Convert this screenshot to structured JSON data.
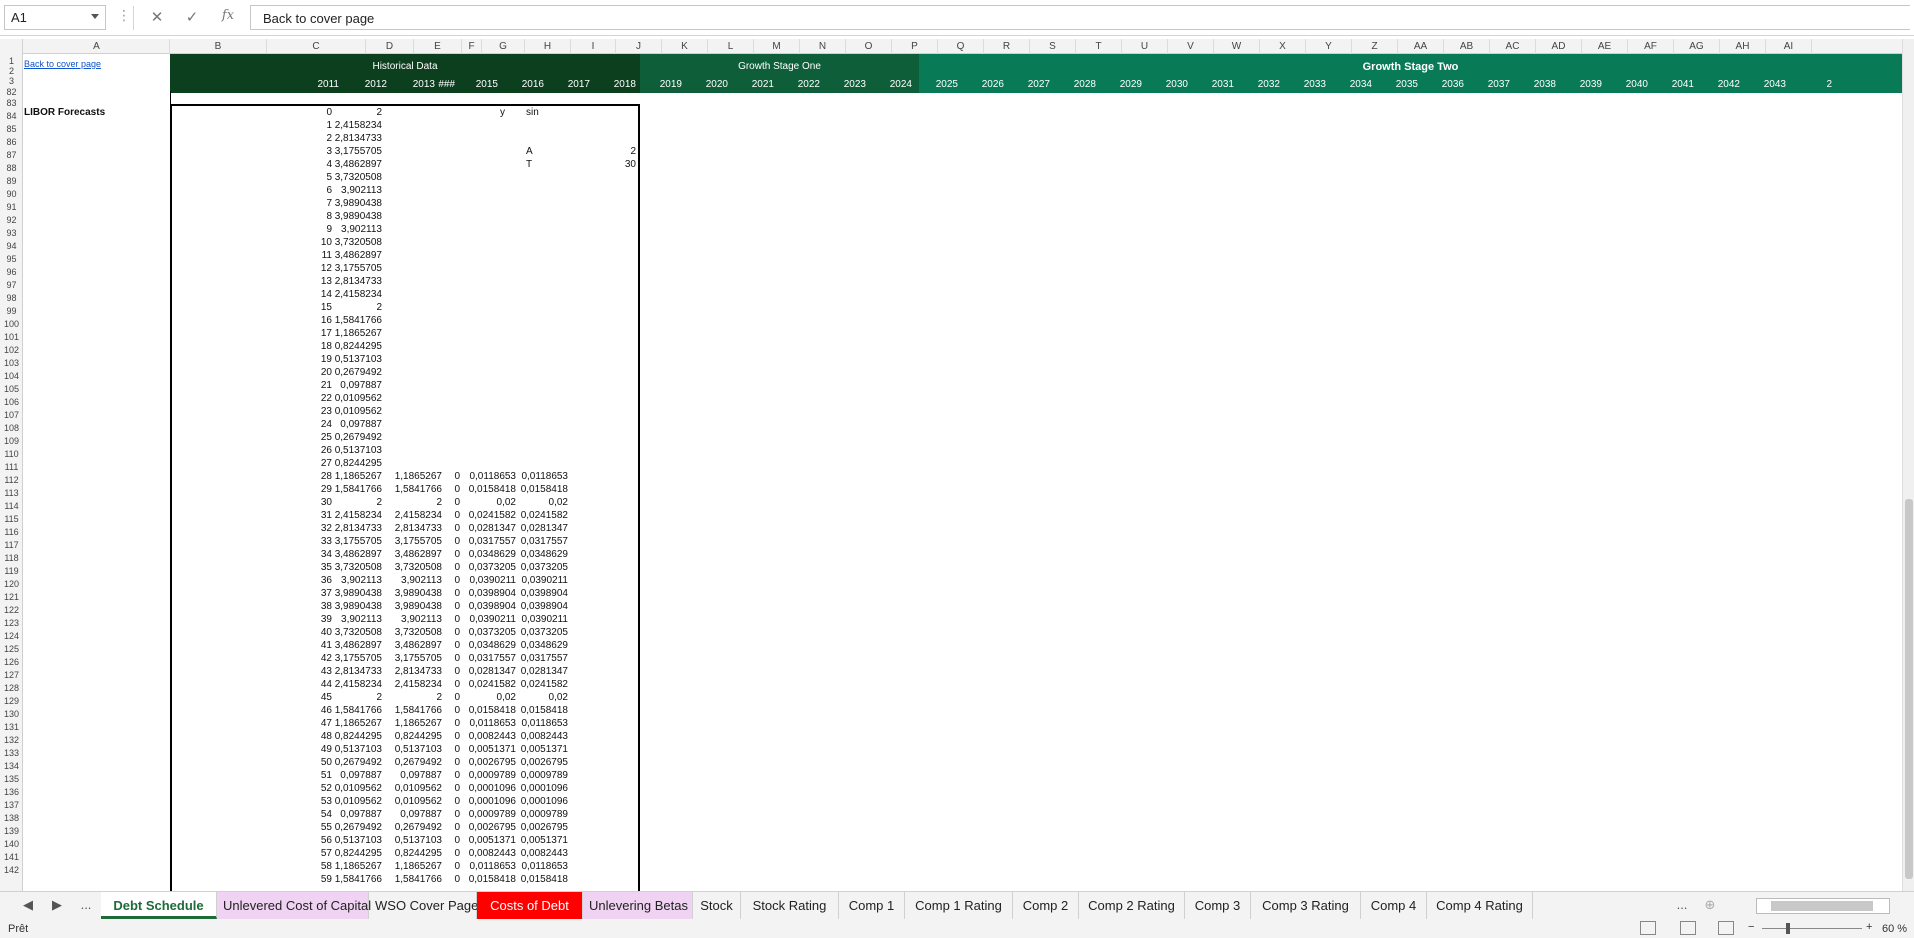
{
  "formula_bar": {
    "name_box": "A1",
    "formula": "Back to cover page",
    "fx": "fx",
    "cancel": "✕",
    "enter": "✓"
  },
  "columns": [
    "A",
    "B",
    "C",
    "D",
    "E",
    "F",
    "G",
    "H",
    "I",
    "J",
    "K",
    "L",
    "M",
    "N",
    "O",
    "P",
    "Q",
    "R",
    "S",
    "T",
    "U",
    "V",
    "W",
    "X",
    "Y",
    "Z",
    "AA",
    "AB",
    "AC",
    "AD",
    "AE",
    "AF",
    "AG",
    "AH",
    "AI"
  ],
  "rows": [
    "1",
    "2",
    "3",
    "82",
    "83",
    "84",
    "85",
    "86",
    "87",
    "88",
    "89",
    "90",
    "91",
    "92",
    "93",
    "94",
    "95",
    "96",
    "97",
    "98",
    "99",
    "100",
    "101",
    "102",
    "103",
    "104",
    "105",
    "106",
    "107",
    "108",
    "109",
    "110",
    "111",
    "112",
    "113",
    "114",
    "115",
    "116",
    "117",
    "118",
    "119",
    "120",
    "121",
    "122",
    "123",
    "124",
    "125",
    "126",
    "127",
    "128",
    "129",
    "130",
    "131",
    "132",
    "133",
    "134",
    "135",
    "136",
    "137",
    "138",
    "139",
    "140",
    "141",
    "142"
  ],
  "header": {
    "link": "Back to cover page",
    "historical": "Historical Data",
    "stage_one": "Growth Stage One",
    "stage_two": "Growth Stage Two",
    "years_hist": [
      "2011",
      "2012",
      "2013",
      "###",
      "2015",
      "2016"
    ],
    "years_one": [
      "2017",
      "2018",
      "2019",
      "2020",
      "2021",
      "2022"
    ],
    "years_two": [
      "2023",
      "2024",
      "2025",
      "2026",
      "2027",
      "2028",
      "2029",
      "2030",
      "2031",
      "2032",
      "2033",
      "2034",
      "2035",
      "2036",
      "2037",
      "2038",
      "2039",
      "2040",
      "2041",
      "2042",
      "2043",
      "2"
    ]
  },
  "section_title": "LIBOR Forecasts",
  "labels": {
    "y": "y",
    "sin": "sin",
    "A": "A",
    "A_val": "2",
    "T": "T",
    "T_val": "30"
  },
  "table": [
    [
      "0",
      "2",
      "",
      "",
      "",
      ""
    ],
    [
      "1",
      "2,4158234",
      "",
      "",
      "",
      ""
    ],
    [
      "2",
      "2,8134733",
      "",
      "",
      "",
      ""
    ],
    [
      "3",
      "3,1755705",
      "",
      "",
      "",
      ""
    ],
    [
      "4",
      "3,4862897",
      "",
      "",
      "",
      ""
    ],
    [
      "5",
      "3,7320508",
      "",
      "",
      "",
      ""
    ],
    [
      "6",
      "3,902113",
      "",
      "",
      "",
      ""
    ],
    [
      "7",
      "3,9890438",
      "",
      "",
      "",
      ""
    ],
    [
      "8",
      "3,9890438",
      "",
      "",
      "",
      ""
    ],
    [
      "9",
      "3,902113",
      "",
      "",
      "",
      ""
    ],
    [
      "10",
      "3,7320508",
      "",
      "",
      "",
      ""
    ],
    [
      "11",
      "3,4862897",
      "",
      "",
      "",
      ""
    ],
    [
      "12",
      "3,1755705",
      "",
      "",
      "",
      ""
    ],
    [
      "13",
      "2,8134733",
      "",
      "",
      "",
      ""
    ],
    [
      "14",
      "2,4158234",
      "",
      "",
      "",
      ""
    ],
    [
      "15",
      "2",
      "",
      "",
      "",
      ""
    ],
    [
      "16",
      "1,5841766",
      "",
      "",
      "",
      ""
    ],
    [
      "17",
      "1,1865267",
      "",
      "",
      "",
      ""
    ],
    [
      "18",
      "0,8244295",
      "",
      "",
      "",
      ""
    ],
    [
      "19",
      "0,5137103",
      "",
      "",
      "",
      ""
    ],
    [
      "20",
      "0,2679492",
      "",
      "",
      "",
      ""
    ],
    [
      "21",
      "0,097887",
      "",
      "",
      "",
      ""
    ],
    [
      "22",
      "0,0109562",
      "",
      "",
      "",
      ""
    ],
    [
      "23",
      "0,0109562",
      "",
      "",
      "",
      ""
    ],
    [
      "24",
      "0,097887",
      "",
      "",
      "",
      ""
    ],
    [
      "25",
      "0,2679492",
      "",
      "",
      "",
      ""
    ],
    [
      "26",
      "0,5137103",
      "",
      "",
      "",
      ""
    ],
    [
      "27",
      "0,8244295",
      "",
      "",
      "",
      ""
    ],
    [
      "28",
      "1,1865267",
      "1,1865267",
      "0",
      "0,0118653",
      "0,0118653"
    ],
    [
      "29",
      "1,5841766",
      "1,5841766",
      "0",
      "0,0158418",
      "0,0158418"
    ],
    [
      "30",
      "2",
      "2",
      "0",
      "0,02",
      "0,02"
    ],
    [
      "31",
      "2,4158234",
      "2,4158234",
      "0",
      "0,0241582",
      "0,0241582"
    ],
    [
      "32",
      "2,8134733",
      "2,8134733",
      "0",
      "0,0281347",
      "0,0281347"
    ],
    [
      "33",
      "3,1755705",
      "3,1755705",
      "0",
      "0,0317557",
      "0,0317557"
    ],
    [
      "34",
      "3,4862897",
      "3,4862897",
      "0",
      "0,0348629",
      "0,0348629"
    ],
    [
      "35",
      "3,7320508",
      "3,7320508",
      "0",
      "0,0373205",
      "0,0373205"
    ],
    [
      "36",
      "3,902113",
      "3,902113",
      "0",
      "0,0390211",
      "0,0390211"
    ],
    [
      "37",
      "3,9890438",
      "3,9890438",
      "0",
      "0,0398904",
      "0,0398904"
    ],
    [
      "38",
      "3,9890438",
      "3,9890438",
      "0",
      "0,0398904",
      "0,0398904"
    ],
    [
      "39",
      "3,902113",
      "3,902113",
      "0",
      "0,0390211",
      "0,0390211"
    ],
    [
      "40",
      "3,7320508",
      "3,7320508",
      "0",
      "0,0373205",
      "0,0373205"
    ],
    [
      "41",
      "3,4862897",
      "3,4862897",
      "0",
      "0,0348629",
      "0,0348629"
    ],
    [
      "42",
      "3,1755705",
      "3,1755705",
      "0",
      "0,0317557",
      "0,0317557"
    ],
    [
      "43",
      "2,8134733",
      "2,8134733",
      "0",
      "0,0281347",
      "0,0281347"
    ],
    [
      "44",
      "2,4158234",
      "2,4158234",
      "0",
      "0,0241582",
      "0,0241582"
    ],
    [
      "45",
      "2",
      "2",
      "0",
      "0,02",
      "0,02"
    ],
    [
      "46",
      "1,5841766",
      "1,5841766",
      "0",
      "0,0158418",
      "0,0158418"
    ],
    [
      "47",
      "1,1865267",
      "1,1865267",
      "0",
      "0,0118653",
      "0,0118653"
    ],
    [
      "48",
      "0,8244295",
      "0,8244295",
      "0",
      "0,0082443",
      "0,0082443"
    ],
    [
      "49",
      "0,5137103",
      "0,5137103",
      "0",
      "0,0051371",
      "0,0051371"
    ],
    [
      "50",
      "0,2679492",
      "0,2679492",
      "0",
      "0,0026795",
      "0,0026795"
    ],
    [
      "51",
      "0,097887",
      "0,097887",
      "0",
      "0,0009789",
      "0,0009789"
    ],
    [
      "52",
      "0,0109562",
      "0,0109562",
      "0",
      "0,0001096",
      "0,0001096"
    ],
    [
      "53",
      "0,0109562",
      "0,0109562",
      "0",
      "0,0001096",
      "0,0001096"
    ],
    [
      "54",
      "0,097887",
      "0,097887",
      "0",
      "0,0009789",
      "0,0009789"
    ],
    [
      "55",
      "0,2679492",
      "0,2679492",
      "0",
      "0,0026795",
      "0,0026795"
    ],
    [
      "56",
      "0,5137103",
      "0,5137103",
      "0",
      "0,0051371",
      "0,0051371"
    ],
    [
      "57",
      "0,8244295",
      "0,8244295",
      "0",
      "0,0082443",
      "0,0082443"
    ],
    [
      "58",
      "1,1865267",
      "1,1865267",
      "0",
      "0,0118653",
      "0,0118653"
    ],
    [
      "59",
      "1,5841766",
      "1,5841766",
      "0",
      "0,0158418",
      "0,0158418"
    ]
  ],
  "tabs": [
    {
      "label": "Debt Schedule",
      "style": "active"
    },
    {
      "label": "Unlevered Cost of Capital",
      "style": "pink"
    },
    {
      "label": "WSO Cover Page",
      "style": "normal"
    },
    {
      "label": "Costs of Debt",
      "style": "red"
    },
    {
      "label": "Unlevering Betas",
      "style": "pink"
    },
    {
      "label": "Stock",
      "style": "normal"
    },
    {
      "label": "Stock Rating",
      "style": "normal"
    },
    {
      "label": "Comp 1",
      "style": "normal"
    },
    {
      "label": "Comp 1 Rating",
      "style": "normal"
    },
    {
      "label": "Comp 2",
      "style": "normal"
    },
    {
      "label": "Comp 2 Rating",
      "style": "normal"
    },
    {
      "label": "Comp 3",
      "style": "normal"
    },
    {
      "label": "Comp 3 Rating",
      "style": "normal"
    },
    {
      "label": "Comp 4",
      "style": "normal"
    },
    {
      "label": "Comp 4 Rating",
      "style": "normal"
    }
  ],
  "tab_nav": {
    "prev": "◀",
    "next": "▶",
    "more_left": "...",
    "more_right": "...",
    "add": "⊕"
  },
  "status": {
    "ready": "Prêt",
    "zoom": "60 %",
    "minus": "−",
    "plus": "+"
  },
  "colors": {
    "dark_green": "#0c3f1e",
    "mid_green": "#0f5e3a",
    "light_green": "#087a55",
    "active_tab": "#1e6b3a",
    "pink_tab": "#f0d2f2",
    "red_tab": "#ff0000"
  }
}
